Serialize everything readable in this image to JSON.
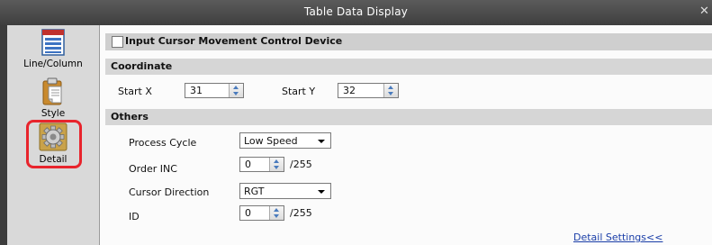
{
  "window": {
    "title": "Table Data Display",
    "close_symbol": "✕"
  },
  "sidebar": {
    "items": [
      {
        "label": "Line/Column",
        "icon": "table-icon"
      },
      {
        "label": "Style",
        "icon": "clipboard-icon"
      },
      {
        "label": "Detail",
        "icon": "gear-icon",
        "selected": true
      }
    ]
  },
  "main": {
    "input_cursor_checkbox": {
      "label": "Input Cursor Movement Control Device",
      "checked": false
    },
    "coordinate": {
      "header": "Coordinate",
      "start_x_label": "Start X",
      "start_x_value": "31",
      "start_y_label": "Start Y",
      "start_y_value": "32"
    },
    "others": {
      "header": "Others",
      "process_cycle_label": "Process Cycle",
      "process_cycle_value": "Low Speed",
      "order_inc_label": "Order INC",
      "order_inc_value": "0",
      "order_inc_max": "/255",
      "cursor_direction_label": "Cursor Direction",
      "cursor_direction_value": "RGT",
      "id_label": "ID",
      "id_value": "0",
      "id_max": "/255"
    },
    "detail_settings_link": "Detail Settings<<"
  },
  "colors": {
    "highlight": "#e8242c",
    "section_header": "#d6d6d6",
    "sidebar": "#d9d9d9",
    "titlebar": "#4a4a4a"
  }
}
